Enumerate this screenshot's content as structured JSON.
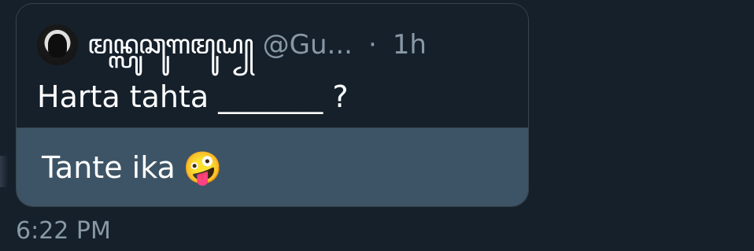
{
  "conversation": {
    "quoted_tweet": {
      "display_name": "ꦩꦤ꧀ꦭꦸꦕꦸꦒꦩꦸꦝ꧀",
      "handle": "@Gu...",
      "separator": "·",
      "time_ago": "1h",
      "text": "Harta tahta _______ ?"
    },
    "message": {
      "text": "Tante ika",
      "emoji": "🤪"
    },
    "timestamp": "6:22 PM"
  },
  "colors": {
    "background": "#15202b",
    "bubble_border": "#38444d",
    "message_bubble": "#3d5466",
    "muted_text": "#8899a6",
    "primary_text": "#ffffff"
  },
  "icons": {
    "avatar": "user-avatar"
  }
}
